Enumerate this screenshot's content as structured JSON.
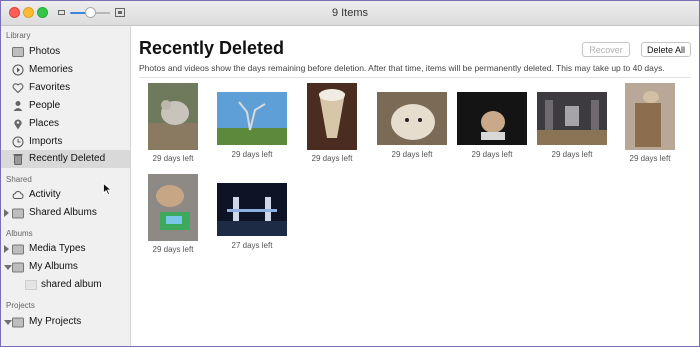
{
  "window": {
    "title": "9 Items"
  },
  "sidebar": {
    "sections": {
      "library": "Library",
      "shared": "Shared",
      "albums": "Albums",
      "projects": "Projects"
    },
    "items": [
      {
        "label": "Photos",
        "icon": "photos-icon"
      },
      {
        "label": "Memories",
        "icon": "memories-icon"
      },
      {
        "label": "Favorites",
        "icon": "heart-icon"
      },
      {
        "label": "People",
        "icon": "person-icon"
      },
      {
        "label": "Places",
        "icon": "pin-icon"
      },
      {
        "label": "Imports",
        "icon": "clock-icon"
      },
      {
        "label": "Recently Deleted",
        "icon": "trash-icon",
        "selected": true
      },
      {
        "label": "Activity",
        "icon": "cloud-icon"
      },
      {
        "label": "Shared Albums",
        "icon": "folder-icon"
      },
      {
        "label": "Media Types",
        "icon": "folder-icon"
      },
      {
        "label": "My Albums",
        "icon": "folder-icon"
      },
      {
        "label": "shared album",
        "icon": "album-thumbnail"
      },
      {
        "label": "My Projects",
        "icon": "folder-icon"
      }
    ]
  },
  "main": {
    "title": "Recently Deleted",
    "recover_label": "Recover",
    "delete_all_label": "Delete All",
    "description": "Photos and videos show the days remaining before deletion. After that time, items will be permanently deleted. This may take up to 40 days.",
    "photos": [
      {
        "caption": "29 days left",
        "subject": "chinchilla"
      },
      {
        "caption": "29 days left",
        "subject": "sculpture"
      },
      {
        "caption": "29 days left",
        "subject": "sundae"
      },
      {
        "caption": "29 days left",
        "subject": "rabbit"
      },
      {
        "caption": "29 days left",
        "subject": "hamster"
      },
      {
        "caption": "29 days left",
        "subject": "church interior"
      },
      {
        "caption": "29 days left",
        "subject": "cat tower"
      },
      {
        "caption": "29 days left",
        "subject": "hamster toy"
      },
      {
        "caption": "27 days left",
        "subject": "tower bridge at night"
      }
    ]
  },
  "colors": {
    "accent": "#3d86d6",
    "selection": "#d9d9d9"
  }
}
